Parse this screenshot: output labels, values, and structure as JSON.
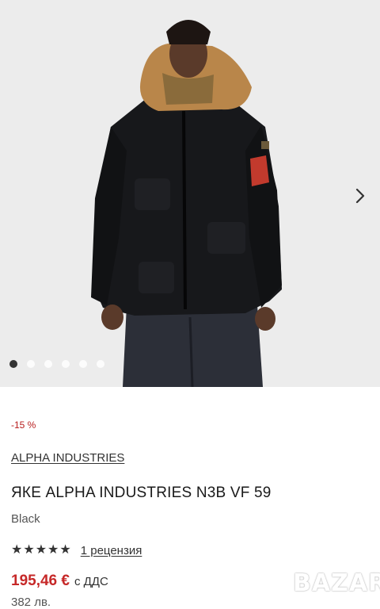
{
  "product": {
    "discount": "-15 %",
    "brand": "ALPHA INDUSTRIES",
    "title": "ЯКЕ ALPHA INDUSTRIES N3B VF 59",
    "color": "Black",
    "rating": 5,
    "reviews": "1 рецензия",
    "price": "195,46 €",
    "vat": "с ДДС",
    "price_bgn": "382 лв."
  },
  "gallery": {
    "images_count": 6,
    "active_index": 0,
    "next_icon": "chevron-right-icon"
  },
  "watermark": "BAZAR",
  "colors": {
    "accent_red": "#c62828",
    "background": "#ebebeb"
  }
}
